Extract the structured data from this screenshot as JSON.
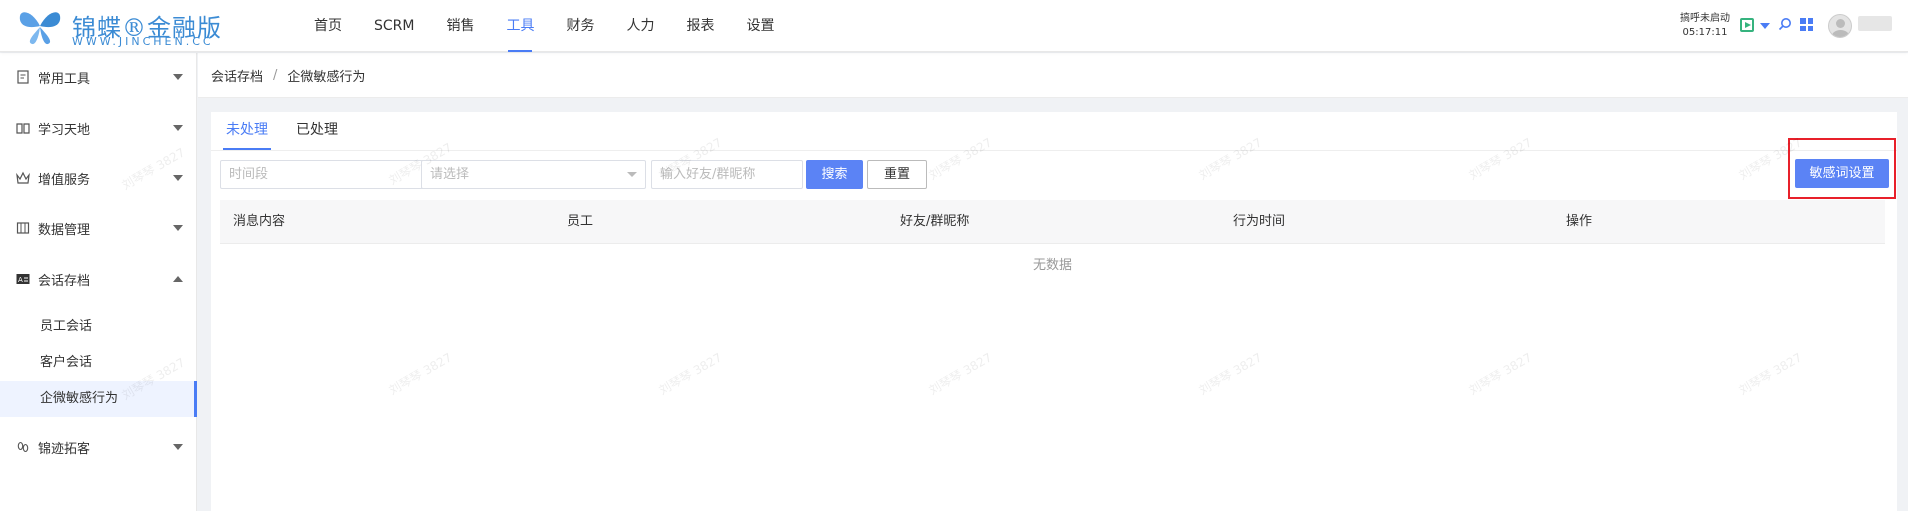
{
  "header": {
    "logo_text": "锦蝶®金融版",
    "logo_sub": "WWW.JINCHEN.CC",
    "nav": [
      {
        "label": "首页",
        "active": false
      },
      {
        "label": "SCRM",
        "active": false
      },
      {
        "label": "销售",
        "active": false
      },
      {
        "label": "工具",
        "active": true
      },
      {
        "label": "财务",
        "active": false
      },
      {
        "label": "人力",
        "active": false
      },
      {
        "label": "报表",
        "active": false
      },
      {
        "label": "设置",
        "active": false
      }
    ],
    "call_status": "搞呼未启动",
    "clock": "05:17:11"
  },
  "sidebar": {
    "groups": [
      {
        "label": "常用工具",
        "icon": "document-icon"
      },
      {
        "label": "学习天地",
        "icon": "book-icon"
      },
      {
        "label": "增值服务",
        "icon": "crown-icon"
      },
      {
        "label": "数据管理",
        "icon": "table-icon"
      },
      {
        "label": "会话存档",
        "icon": "chat-archive-icon",
        "expanded": true
      },
      {
        "label": "锦迹拓客",
        "icon": "footprint-icon"
      }
    ],
    "sub_items": [
      {
        "label": "员工会话",
        "active": false
      },
      {
        "label": "客户会话",
        "active": false
      },
      {
        "label": "企微敏感行为",
        "active": true
      }
    ]
  },
  "breadcrumb": {
    "parent": "会话存档",
    "separator": "/",
    "current": "企微敏感行为"
  },
  "tabs": [
    {
      "label": "未处理",
      "active": true
    },
    {
      "label": "已处理",
      "active": false
    }
  ],
  "filters": {
    "time_placeholder": "时间段",
    "select_placeholder": "请选择",
    "friend_placeholder": "输入好友/群昵称",
    "search_label": "搜索",
    "reset_label": "重置"
  },
  "actions": {
    "sensitive_words_label": "敏感词设置"
  },
  "table": {
    "columns": [
      "消息内容",
      "员工",
      "好友/群昵称",
      "行为时间",
      "操作"
    ],
    "rows": [],
    "empty_text": "无数据"
  },
  "watermark": "刘琴琴 3827",
  "colors": {
    "accent": "#4a7cf5",
    "primary_button": "#5b83f5",
    "highlight_border": "#e8202a"
  }
}
